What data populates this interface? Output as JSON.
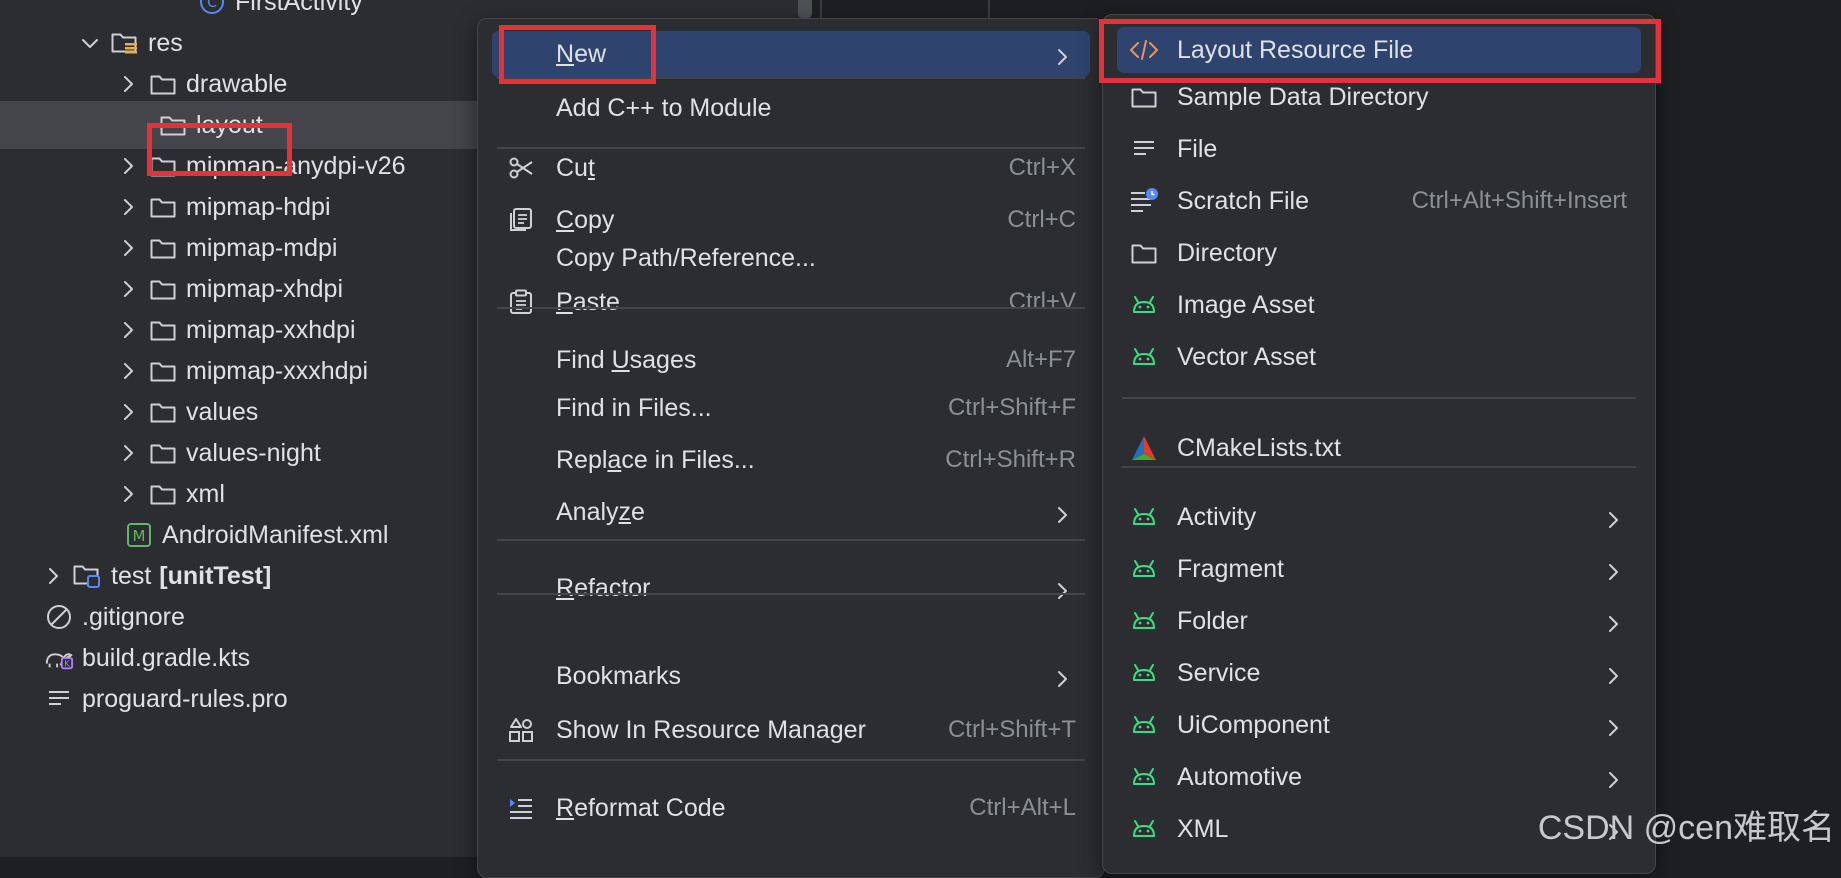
{
  "project_tree": {
    "items": [
      {
        "label": "FirstActivity",
        "icon": "class-icon",
        "expander": "none"
      },
      {
        "label": "res",
        "icon": "resource-folder-icon",
        "expander": "expanded"
      },
      {
        "label": "drawable",
        "icon": "folder-icon",
        "expander": "collapsed"
      },
      {
        "label": "layout",
        "icon": "folder-icon",
        "expander": "none",
        "selected": true
      },
      {
        "label": "mipmap-anydpi-v26",
        "icon": "folder-icon",
        "expander": "collapsed"
      },
      {
        "label": "mipmap-hdpi",
        "icon": "folder-icon",
        "expander": "collapsed"
      },
      {
        "label": "mipmap-mdpi",
        "icon": "folder-icon",
        "expander": "collapsed"
      },
      {
        "label": "mipmap-xhdpi",
        "icon": "folder-icon",
        "expander": "collapsed"
      },
      {
        "label": "mipmap-xxhdpi",
        "icon": "folder-icon",
        "expander": "collapsed"
      },
      {
        "label": "mipmap-xxxhdpi",
        "icon": "folder-icon",
        "expander": "collapsed"
      },
      {
        "label": "values",
        "icon": "folder-icon",
        "expander": "collapsed"
      },
      {
        "label": "values-night",
        "icon": "folder-icon",
        "expander": "collapsed"
      },
      {
        "label": "xml",
        "icon": "folder-icon",
        "expander": "collapsed"
      },
      {
        "label": "AndroidManifest.xml",
        "icon": "manifest-icon",
        "expander": "none"
      },
      {
        "label": "test",
        "label_suffix": "[unitTest]",
        "icon": "test-folder-icon",
        "expander": "collapsed"
      },
      {
        "label": ".gitignore",
        "icon": "ignore-file-icon",
        "expander": "none"
      },
      {
        "label": "build.gradle.kts",
        "icon": "gradle-icon",
        "expander": "none"
      },
      {
        "label": "proguard-rules.pro",
        "icon": "text-file-icon",
        "expander": "none"
      }
    ]
  },
  "context_menu": {
    "items": [
      {
        "label": "New",
        "mnemonic": "N",
        "submenu": true,
        "highlighted": true
      },
      {
        "separator": true
      },
      {
        "label": "Add C++ to Module"
      },
      {
        "separator": true
      },
      {
        "label": "Cut",
        "mnemonic": "t",
        "shortcut": "Ctrl+X",
        "icon": "cut-icon"
      },
      {
        "label": "Copy",
        "mnemonic": "C",
        "shortcut": "Ctrl+C",
        "icon": "copy-icon"
      },
      {
        "label": "Copy Path/Reference..."
      },
      {
        "label": "Paste",
        "mnemonic": "P",
        "shortcut": "Ctrl+V",
        "icon": "paste-icon"
      },
      {
        "separator": true
      },
      {
        "label": "Find Usages",
        "mnemonic": "U",
        "shortcut": "Alt+F7"
      },
      {
        "label": "Find in Files...",
        "shortcut": "Ctrl+Shift+F"
      },
      {
        "label": "Replace in Files...",
        "mnemonic": "a",
        "shortcut": "Ctrl+Shift+R"
      },
      {
        "label": "Analyze",
        "mnemonic": "z",
        "submenu": true
      },
      {
        "separator": true
      },
      {
        "label": "Refactor",
        "mnemonic": "R",
        "submenu": true
      },
      {
        "separator": true
      },
      {
        "label": "Bookmarks",
        "submenu": true
      },
      {
        "label": "Show In Resource Manager",
        "shortcut": "Ctrl+Shift+T",
        "icon": "resource-manager-icon"
      },
      {
        "separator": true
      },
      {
        "label": "Reformat Code",
        "mnemonic": "R",
        "shortcut": "Ctrl+Alt+L",
        "icon": "reformat-icon"
      }
    ]
  },
  "new_submenu": {
    "items": [
      {
        "label": "Layout Resource File",
        "icon": "layout-file-icon",
        "highlighted": true
      },
      {
        "label": "Sample Data Directory",
        "icon": "folder-icon"
      },
      {
        "label": "File",
        "icon": "text-file-icon"
      },
      {
        "label": "Scratch File",
        "icon": "scratch-file-icon",
        "shortcut": "Ctrl+Alt+Shift+Insert"
      },
      {
        "label": "Directory",
        "icon": "folder-icon"
      },
      {
        "label": "Image Asset",
        "icon": "android-icon"
      },
      {
        "label": "Vector Asset",
        "icon": "android-icon"
      },
      {
        "separator": true
      },
      {
        "label": "CMakeLists.txt",
        "icon": "cmake-icon"
      },
      {
        "separator": true
      },
      {
        "label": "Activity",
        "icon": "android-icon",
        "submenu": true
      },
      {
        "label": "Fragment",
        "icon": "android-icon",
        "submenu": true
      },
      {
        "label": "Folder",
        "icon": "android-icon",
        "submenu": true
      },
      {
        "label": "Service",
        "icon": "android-icon",
        "submenu": true
      },
      {
        "label": "UiComponent",
        "icon": "android-icon",
        "submenu": true
      },
      {
        "label": "Automotive",
        "icon": "android-icon",
        "submenu": true
      },
      {
        "label": "XML",
        "icon": "android-icon",
        "submenu": true
      }
    ]
  },
  "watermark": "CSDN @cen难取名",
  "colors": {
    "menu_highlight": "#2e436e",
    "annotation_red": "#e5323a",
    "android_green": "#3ddc84",
    "layout_icon_orange": "#e8955c"
  }
}
